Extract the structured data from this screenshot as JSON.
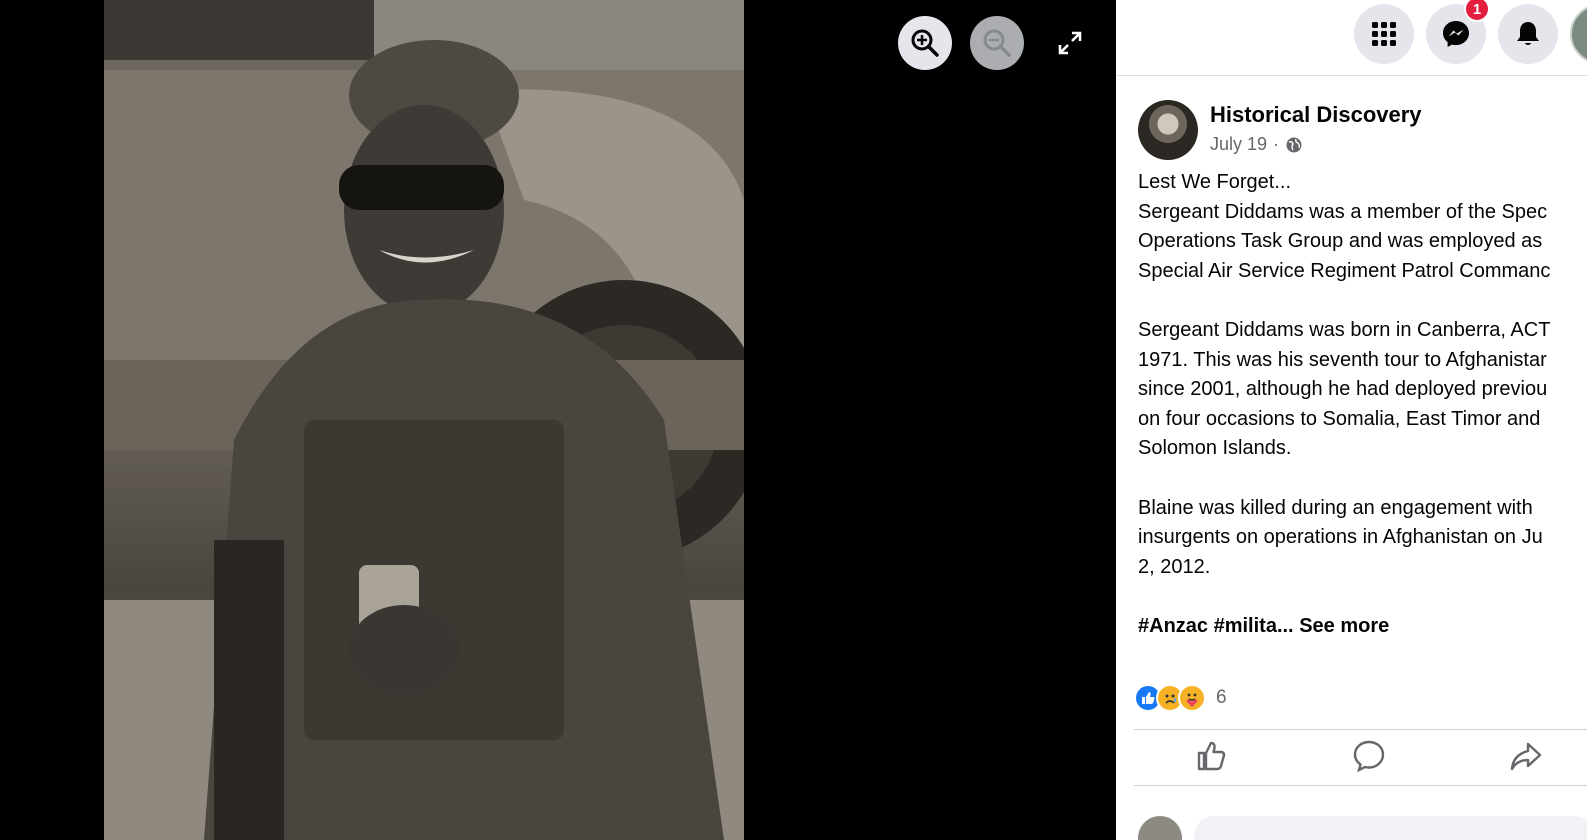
{
  "viewer": {
    "photo_alt": "soldier-photo",
    "controls": [
      {
        "name": "zoom-in-button",
        "icon": "zoom-in-icon"
      },
      {
        "name": "zoom-out-button",
        "icon": "zoom-out-icon"
      },
      {
        "name": "fullscreen-button",
        "icon": "expand-icon"
      }
    ]
  },
  "topbar": {
    "icons": [
      "menu-grid-icon",
      "messenger-icon",
      "bell-icon"
    ],
    "messenger_badge": "1"
  },
  "post": {
    "author": "Historical Discovery",
    "date": "July 19",
    "separator": "·",
    "privacy_icon": "globe-icon",
    "body_lines": [
      "Lest We Forget...",
      "Sergeant Diddams was a member of the Spec",
      "Operations Task Group and was employed as",
      "Special Air Service Regiment Patrol Commanc"
    ],
    "paragraph2_lines": [
      "Sergeant Diddams was born in Canberra, ACT",
      "1971. This was his seventh tour to Afghanistar",
      "since 2001, although he had deployed previou",
      "on four occasions to Somalia, East Timor and",
      "Solomon Islands."
    ],
    "paragraph3_lines": [
      "Blaine was killed during an engagement with",
      "insurgents on operations in Afghanistan on Ju",
      "2, 2012."
    ],
    "tags": "#Anzac #milita...",
    "see_more": "See more",
    "reaction_count": "6",
    "reaction_icons": [
      "like-icon",
      "sad-icon",
      "care-icon"
    ],
    "actions": [
      "like-action-icon",
      "comment-action-icon",
      "share-action-icon"
    ]
  },
  "colors": {
    "accent": "#1877f2",
    "badge": "#e41e3f",
    "secondary_text": "#65676b"
  }
}
